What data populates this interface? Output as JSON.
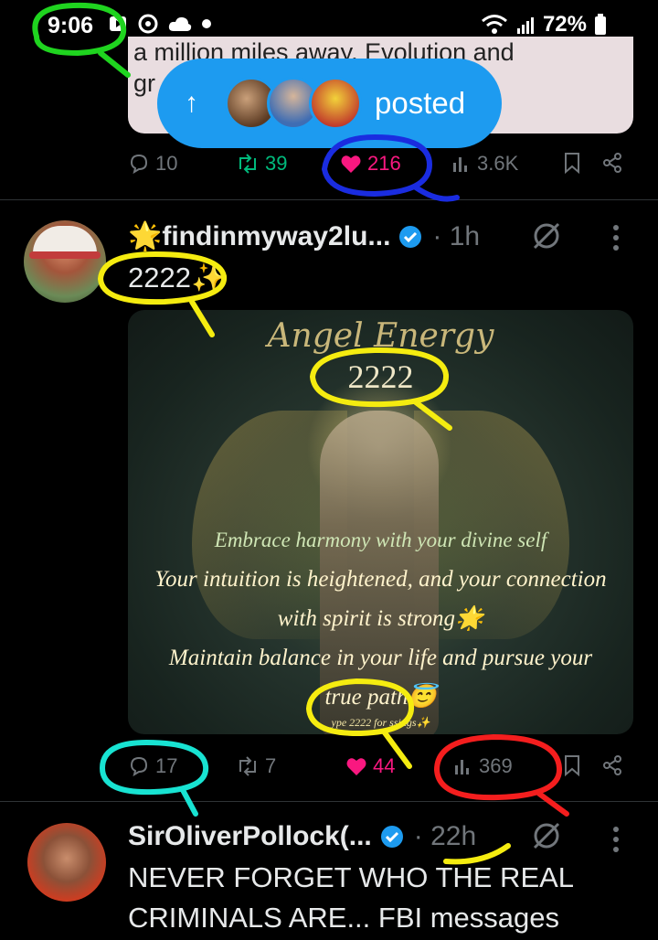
{
  "status": {
    "time": "9:06",
    "battery": "72%"
  },
  "previous_tweet": {
    "text_line1": "a million miles away. Evolution and",
    "text_line2": "gr",
    "replies": "10",
    "reposts": "39",
    "likes": "216",
    "views": "3.6K"
  },
  "posted_pill": {
    "label": "posted"
  },
  "tweet1": {
    "name": "🌟findinmyway2lu...",
    "time": "· 1h",
    "text": "2222✨",
    "media": {
      "title": "Angel Energy",
      "number": "2222",
      "line1": "Embrace harmony with your divine self",
      "line2": "Your intuition is heightened, and your connection",
      "line3": "with spirit is strong🌟",
      "line4": "Maintain balance in your life and pursue your",
      "line5": "true path😇",
      "footer": "ype 2222 for  ssings✨"
    },
    "replies": "17",
    "reposts": "7",
    "likes": "44",
    "views": "369"
  },
  "tweet2": {
    "name": "SirOliverPollock(...",
    "time": "· 22h",
    "text_line1": "NEVER FORGET WHO THE REAL",
    "text_line2": "CRIMINALS ARE... FBI messages"
  },
  "annotation_colors": {
    "green": "#1fd41f",
    "blue": "#1a2ce0",
    "yellow": "#f5ec10",
    "cyan": "#18e3d2",
    "red": "#f41e1e"
  }
}
